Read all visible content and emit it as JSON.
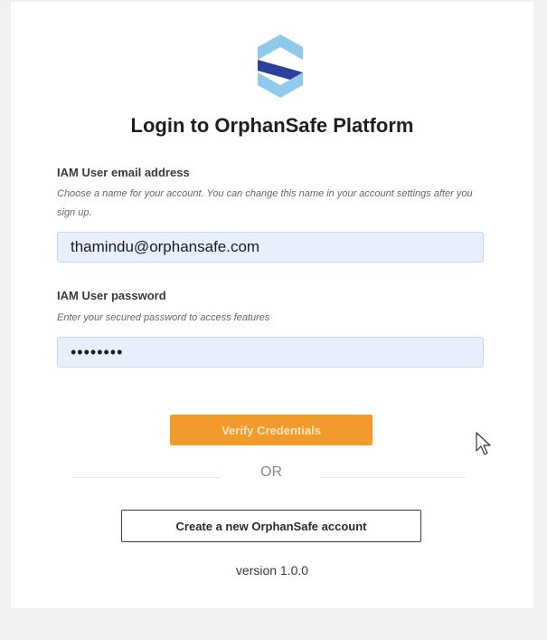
{
  "login": {
    "title": "Login to OrphanSafe Platform",
    "email": {
      "label": "IAM User email address",
      "help": "Choose a name for your account. You can change this name in your account settings after you sign up.",
      "value": "thamindu@orphansafe.com"
    },
    "password": {
      "label": "IAM User password",
      "help": "Enter your secured password to access features",
      "value": "••••••••"
    },
    "verify_label": "Verify Credentials",
    "or_label": "OR",
    "create_label": "Create a new OrphanSafe account",
    "version": "version 1.0.0"
  },
  "colors": {
    "accent": "#f39a2c",
    "input_bg": "#e8effc",
    "logo_dark": "#2a3f9e",
    "logo_light": "#8fc9ec"
  },
  "icons": {
    "logo": "orphansafe-logo-icon",
    "cursor": "mouse-pointer-icon"
  }
}
